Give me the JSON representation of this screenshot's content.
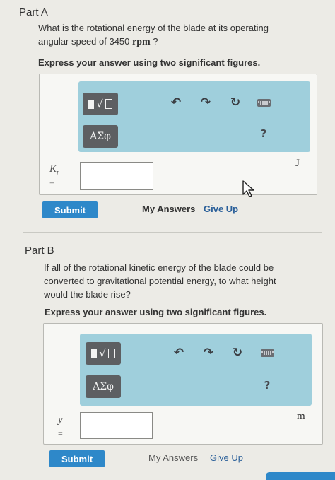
{
  "part_a": {
    "title": "Part A",
    "question_line1": "What is the rotational energy of the blade at its operating",
    "question_line2_prefix": "angular speed of 3450 ",
    "question_unit": "rpm",
    "question_suffix": " ?",
    "instruction": "Express your answer using two significant figures.",
    "variable": "K",
    "variable_subscript": "r",
    "equals": "=",
    "input_value": "",
    "unit": "J",
    "submit_label": "Submit",
    "my_answers_label": "My Answers",
    "give_up_label": "Give Up"
  },
  "part_b": {
    "title": "Part B",
    "question_line1": "If all of the rotational kinetic energy of the blade could be",
    "question_line2": "converted to gravitational potential energy, to what height",
    "question_line3": "would the blade rise?",
    "instruction": "Express your answer using two significant figures.",
    "variable": "y",
    "equals": "=",
    "input_value": "",
    "unit": "m",
    "submit_label": "Submit",
    "my_answers_label": "My Answers",
    "give_up_label": "Give Up"
  },
  "toolbar": {
    "greek_label": "ΑΣφ",
    "help_label": "?",
    "icons": [
      "templates-icon",
      "undo-icon",
      "redo-icon",
      "reset-icon",
      "keyboard-icon",
      "help-icon"
    ]
  },
  "colors": {
    "toolbar_bg": "#9fcfdc",
    "button_dark": "#5d5f62",
    "submit_blue": "#2e88c9",
    "link_blue": "#2a5f99"
  }
}
